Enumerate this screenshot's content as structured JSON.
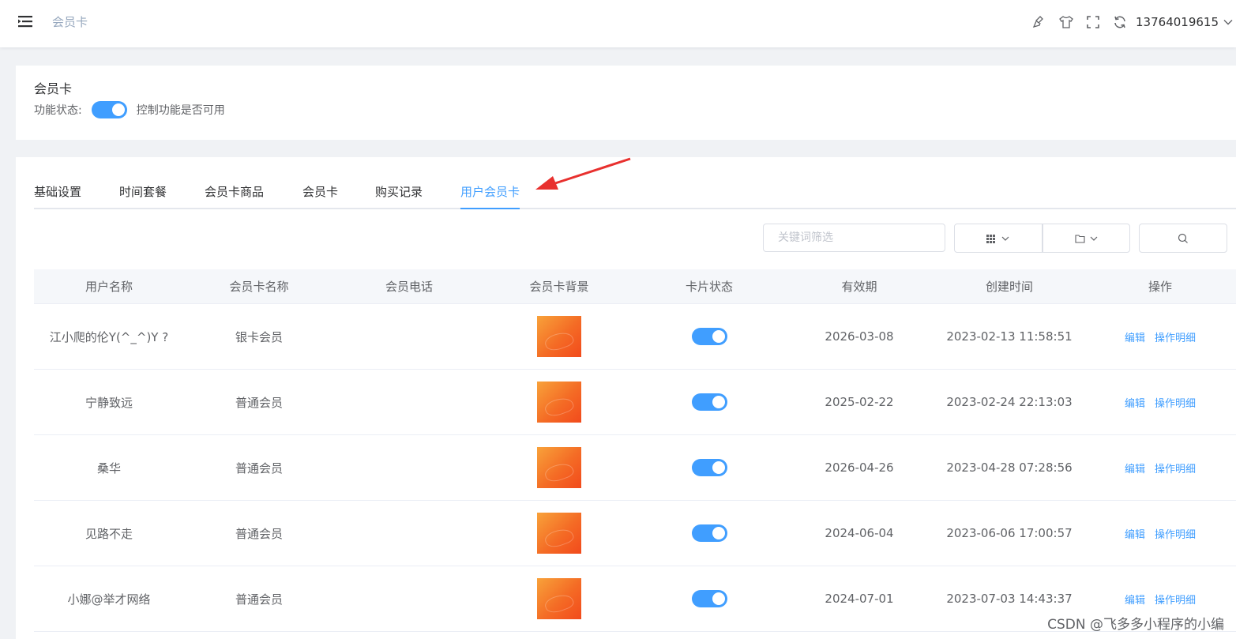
{
  "header": {
    "breadcrumb": "会员卡",
    "user_phone": "13764019615",
    "icons": [
      "brush-icon",
      "shirt-icon",
      "fullscreen-icon",
      "refresh-icon"
    ]
  },
  "function_card": {
    "title": "会员卡",
    "status_label": "功能状态:",
    "status_on": true,
    "hint": "控制功能是否可用"
  },
  "tabs": [
    {
      "label": "基础设置",
      "active": false
    },
    {
      "label": "时间套餐",
      "active": false
    },
    {
      "label": "会员卡商品",
      "active": false
    },
    {
      "label": "会员卡",
      "active": false
    },
    {
      "label": "购买记录",
      "active": false
    },
    {
      "label": "用户会员卡",
      "active": true
    }
  ],
  "toolbar": {
    "search_placeholder": "关键词筛选"
  },
  "table": {
    "columns": [
      "用户名称",
      "会员卡名称",
      "会员电话",
      "会员卡背景",
      "卡片状态",
      "有效期",
      "创建时间",
      "操作"
    ],
    "rows": [
      {
        "user": "江小爬的伦Y(^_^)Y ?",
        "card": "银卡会员",
        "phone": "",
        "enabled": true,
        "expire": "2026-03-08",
        "created": "2023-02-13 11:58:51"
      },
      {
        "user": "宁静致远",
        "card": "普通会员",
        "phone": "",
        "enabled": true,
        "expire": "2025-02-22",
        "created": "2023-02-24 22:13:03"
      },
      {
        "user": "桑华",
        "card": "普通会员",
        "phone": "",
        "enabled": true,
        "expire": "2026-04-26",
        "created": "2023-04-28 07:28:56"
      },
      {
        "user": "见路不走",
        "card": "普通会员",
        "phone": "",
        "enabled": true,
        "expire": "2024-06-04",
        "created": "2023-06-06 17:00:57"
      },
      {
        "user": "小娜@举才网络",
        "card": "普通会员",
        "phone": "",
        "enabled": true,
        "expire": "2024-07-01",
        "created": "2023-07-03 14:43:37"
      }
    ],
    "op_edit": "编辑",
    "op_detail": "操作明细"
  },
  "watermark": "CSDN @飞多多小程序的小编",
  "colors": {
    "primary": "#409eff",
    "annotation_arrow": "#e8302e"
  }
}
